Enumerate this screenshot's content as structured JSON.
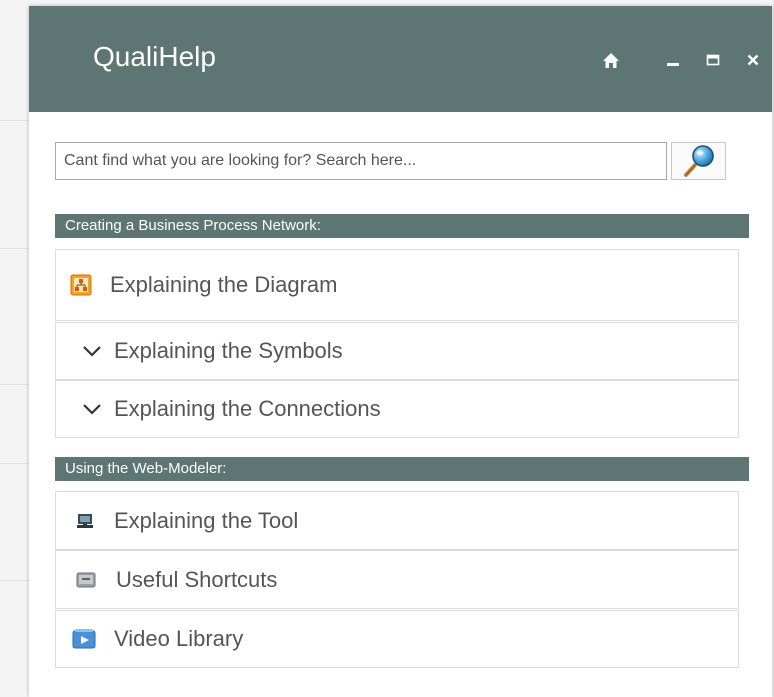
{
  "window": {
    "title": "QualiHelp",
    "controls": [
      "home-icon",
      "minimize-icon",
      "maximize-icon",
      "close-icon"
    ]
  },
  "search": {
    "placeholder": "Cant find what you are looking for? Search here...",
    "value": "",
    "button_icon": "magnifier-icon"
  },
  "sections": [
    {
      "header": "Creating a Business Process Network:",
      "items": [
        {
          "label": "Explaining the Diagram",
          "icon": "diagram-icon"
        },
        {
          "label": "Explaining the Symbols",
          "icon": "chevron-down-icon"
        },
        {
          "label": "Explaining the Connections",
          "icon": "chevron-down-icon"
        }
      ]
    },
    {
      "header": "Using the Web-Modeler:",
      "items": [
        {
          "label": "Explaining the Tool",
          "icon": "tool-icon"
        },
        {
          "label": "Useful Shortcuts",
          "icon": "ctrl-key-icon"
        },
        {
          "label": "Video Library",
          "icon": "video-icon"
        }
      ]
    }
  ],
  "colors": {
    "titlebar": "#5d7573",
    "section_header": "#5d7573",
    "text": "#555555"
  }
}
